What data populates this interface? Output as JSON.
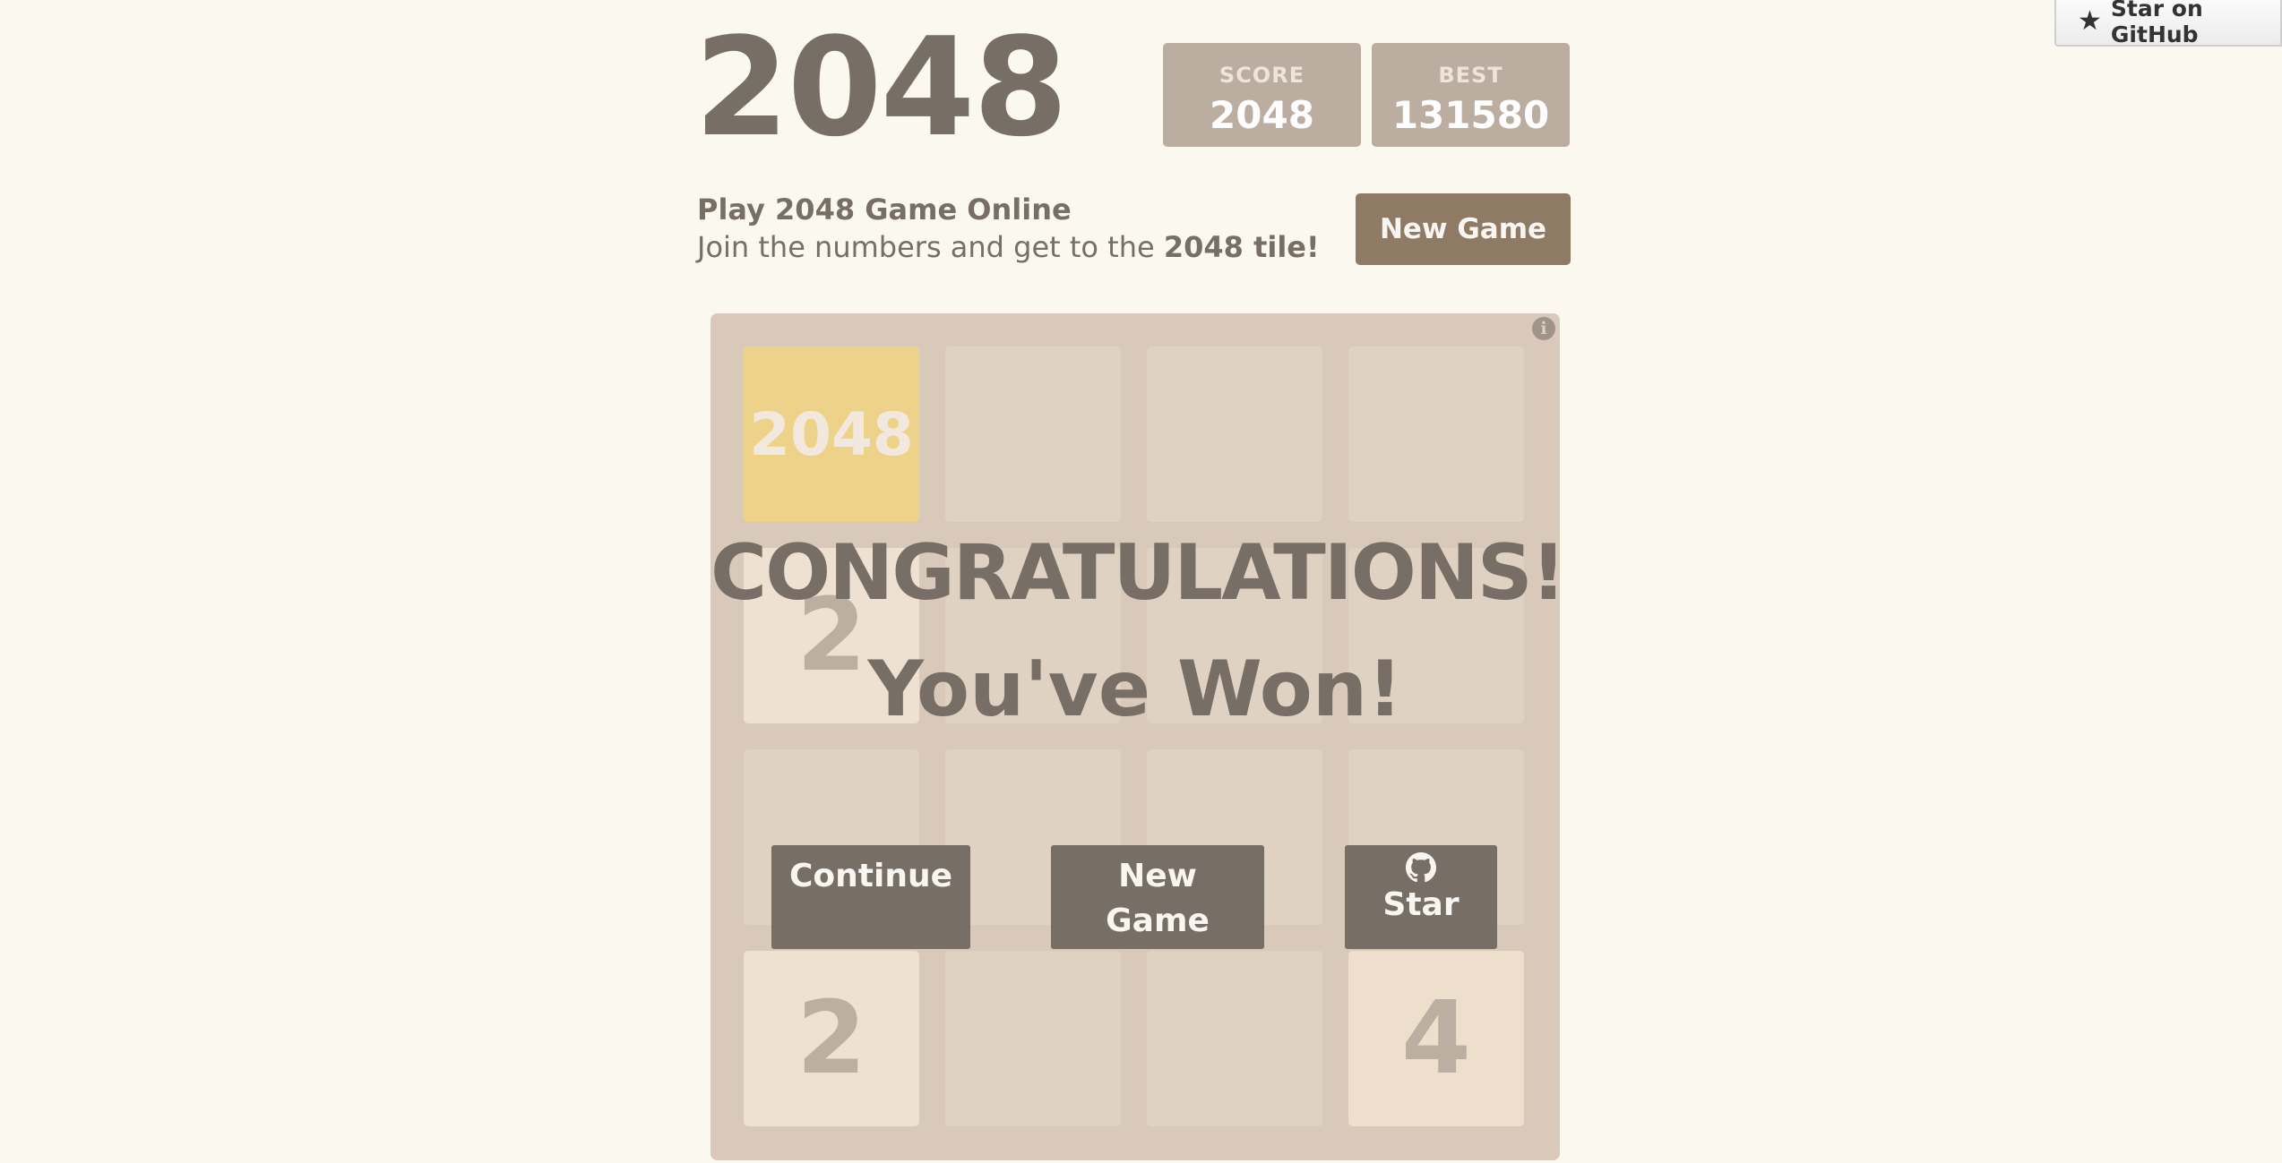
{
  "github_ribbon": {
    "icon": "star-icon",
    "label": "Star on GitHub"
  },
  "header": {
    "title": "2048",
    "score": {
      "label": "SCORE",
      "value": "2048"
    },
    "best": {
      "label": "BEST",
      "value": "131580"
    },
    "new_game_label": "New Game"
  },
  "intro": {
    "title": "Play 2048 Game Online",
    "text_before": "Join the numbers and get to the ",
    "text_bold": "2048 tile!"
  },
  "board": {
    "info_icon": "i",
    "tiles": [
      {
        "value": "2048",
        "row": 1,
        "col": 1
      },
      {
        "value": "2",
        "row": 2,
        "col": 1
      },
      {
        "value": "2",
        "row": 4,
        "col": 1
      },
      {
        "value": "4",
        "row": 4,
        "col": 4
      }
    ]
  },
  "overlay": {
    "title": "CONGRATULATIONS!",
    "subtitle": "You've Won!",
    "continue_label": "Continue",
    "new_game_line1": "New",
    "new_game_line2": "Game",
    "star_label": "Star",
    "star_icon": "github-icon"
  },
  "colors": {
    "background": "#faf8ef",
    "board": "#bbada0",
    "text": "#776e65",
    "button": "#8f7a66",
    "overlay_button": "#776e65",
    "tile_2": "#eee4da",
    "tile_4": "#ede0c8",
    "tile_2048": "#edc22e"
  }
}
